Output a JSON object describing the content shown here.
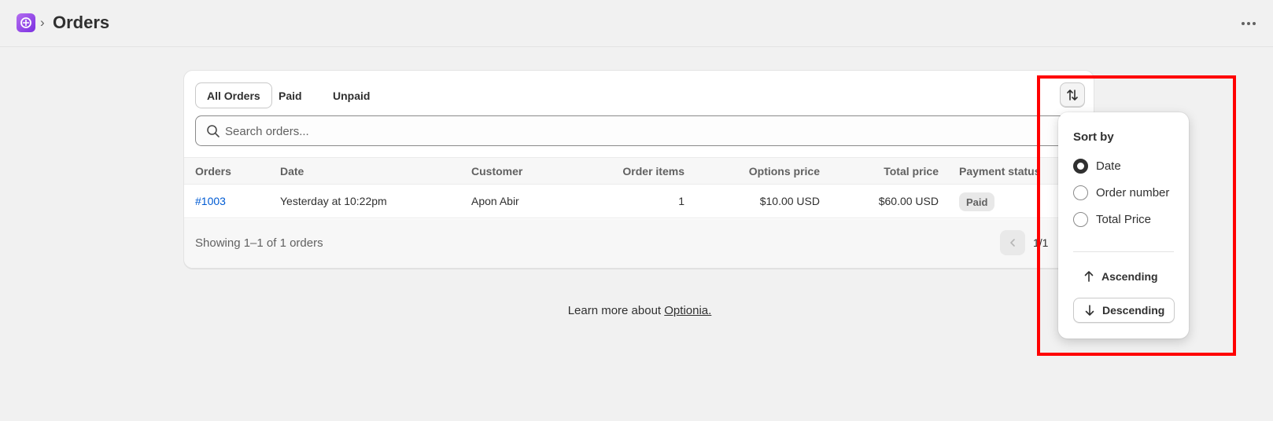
{
  "header": {
    "app_logo_icon": "app-logo-icon",
    "breadcrumb_separator": "›",
    "title": "Orders",
    "more_icon": "more-horizontal-icon"
  },
  "tabs": [
    {
      "label": "All Orders",
      "active": true
    },
    {
      "label": "Paid",
      "active": false
    },
    {
      "label": "Unpaid",
      "active": false
    }
  ],
  "search": {
    "placeholder": "Search orders...",
    "value": ""
  },
  "table": {
    "columns": [
      "Orders",
      "Date",
      "Customer",
      "Order items",
      "Options price",
      "Total price",
      "Payment status"
    ],
    "rows": [
      {
        "order": "#1003",
        "date": "Yesterday at 10:22pm",
        "customer": "Apon Abir",
        "items": "1",
        "options_price": "$10.00 USD",
        "total_price": "$60.00 USD",
        "payment_status": "Paid"
      }
    ]
  },
  "footer": {
    "showing": "Showing 1–1 of 1 orders",
    "page_indicator": "1/1"
  },
  "learn_more": {
    "prefix": "Learn more about ",
    "link": "Optionia."
  },
  "sort_popover": {
    "title": "Sort by",
    "options": [
      {
        "label": "Date",
        "checked": true
      },
      {
        "label": "Order number",
        "checked": false
      },
      {
        "label": "Total Price",
        "checked": false
      }
    ],
    "ascending_label": "Ascending",
    "descending_label": "Descending",
    "selected_direction": "Descending"
  },
  "colors": {
    "accent_link": "#005bd3",
    "highlight": "#ff0000",
    "logo": "#9b4de8"
  }
}
